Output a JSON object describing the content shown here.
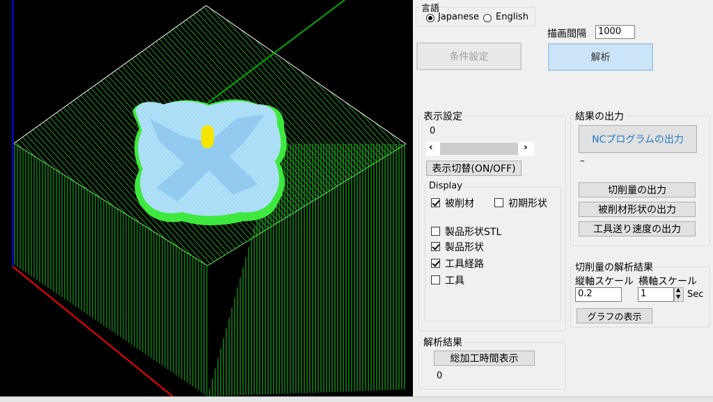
{
  "language": {
    "label": "言語",
    "options": [
      "Japanese",
      "English"
    ],
    "selected": "Japanese"
  },
  "interval": {
    "label": "描画間隔",
    "value": "1000"
  },
  "buttons": {
    "conditions": "条件設定",
    "analyze": "解析"
  },
  "display_settings": {
    "title": "表示設定",
    "value": "0",
    "toggle_label": "表示切替(ON/OFF)",
    "display_group": {
      "title": "Display",
      "items": [
        {
          "label": "被削材",
          "checked": true
        },
        {
          "label": "初期形状",
          "checked": false
        },
        {
          "label": "製品形状STL",
          "checked": false
        },
        {
          "label": "製品形状",
          "checked": true
        },
        {
          "label": "工具経路",
          "checked": true
        },
        {
          "label": "工具",
          "checked": false
        }
      ]
    }
  },
  "results_output": {
    "title": "結果の出力",
    "nc_button": "NCプログラムの出力",
    "dash": "–",
    "buttons": [
      "切削量の出力",
      "被削材形状の出力",
      "工具送り速度の出力"
    ]
  },
  "cut_analysis": {
    "title": "切削量の解析結果",
    "vertical_label": "縦軸スケール",
    "horizontal_label": "横軸スケール",
    "vertical_value": "0.2",
    "horizontal_value": "1",
    "unit": "Sec",
    "graph_button": "グラフの表示"
  },
  "analysis_results": {
    "title": "解析結果",
    "button": "総加工時間表示",
    "value": "0"
  },
  "viewport_colors": {
    "background": "#000000",
    "stock": "#22cc22",
    "edge": "#ffffff",
    "product": "#a8dcf5",
    "tool": "#f4e600",
    "axis_x": "#ff0000",
    "axis_y": "#00b000",
    "axis_z": "#0000ff"
  }
}
